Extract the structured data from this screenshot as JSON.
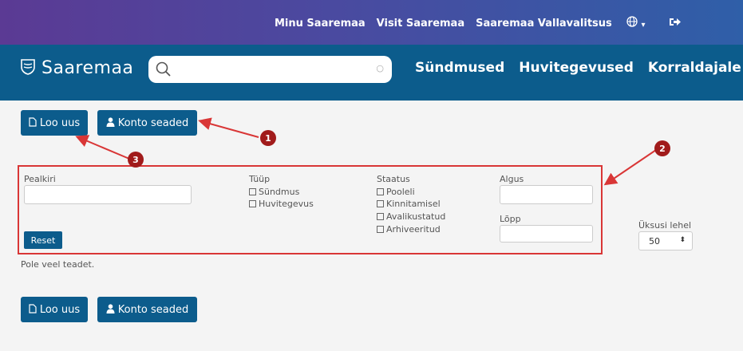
{
  "topbar": {
    "links": [
      "Minu Saaremaa",
      "Visit Saaremaa",
      "Saaremaa Vallavalitsus"
    ],
    "language_icon": "globe-icon",
    "logout_icon": "logout-icon"
  },
  "header": {
    "logo_text": "Saaremaa",
    "search": {
      "value": "",
      "placeholder": ""
    },
    "nav": [
      "Sündmused",
      "Huvitegevused",
      "Korraldajale"
    ]
  },
  "actions": {
    "new_label": "Loo uus",
    "settings_label": "Konto seaded"
  },
  "filters": {
    "title_label": "Pealkiri",
    "type_label": "Tüüp",
    "type_options": [
      "Sündmus",
      "Huvitegevus"
    ],
    "status_label": "Staatus",
    "status_options": [
      "Pooleli",
      "Kinnitamisel",
      "Avalikustatud",
      "Arhiveeritud"
    ],
    "start_label": "Algus",
    "end_label": "Lõpp",
    "reset_label": "Reset"
  },
  "per_page": {
    "label": "Üksusi lehel",
    "value": "50"
  },
  "empty_message": "Pole veel teadet.",
  "callouts": [
    "1",
    "2",
    "3"
  ],
  "colors": {
    "primary": "#0c5c8c",
    "annotation": "#d93636"
  }
}
